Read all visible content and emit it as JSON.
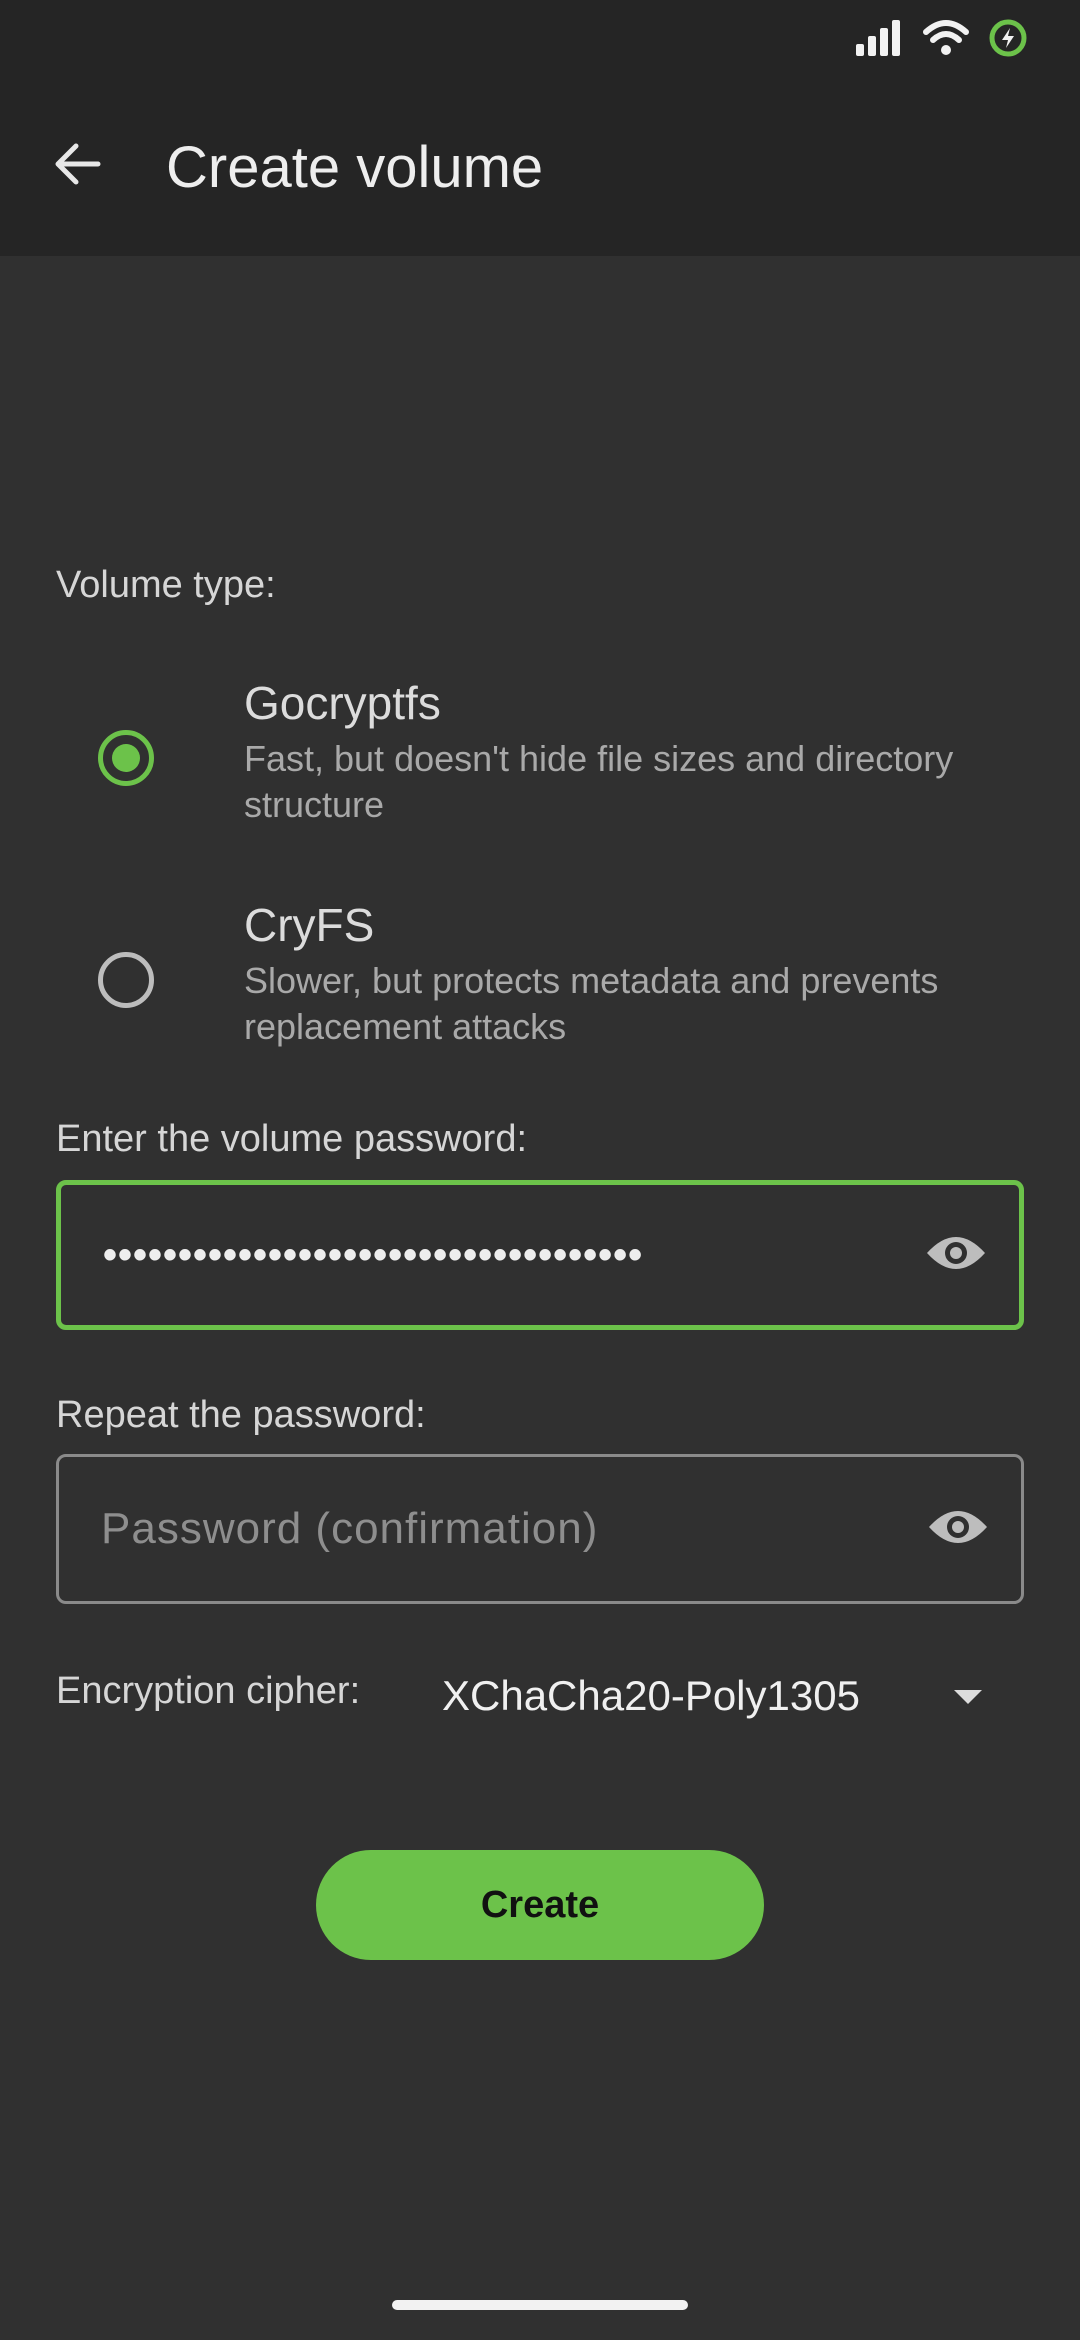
{
  "header": {
    "title": "Create volume",
    "back_icon": "arrow-back-icon"
  },
  "status_bar": {
    "icons": [
      "signal-icon",
      "wifi-icon",
      "battery-charging-icon"
    ]
  },
  "volume_type": {
    "label": "Volume type:",
    "options": [
      {
        "title": "Gocryptfs",
        "description": "Fast, but doesn't hide file sizes and directory structure",
        "selected": true
      },
      {
        "title": "CryFS",
        "description": "Slower, but protects metadata and prevents replacement attacks",
        "selected": false
      }
    ]
  },
  "password": {
    "label": "Enter the volume password:",
    "value": "••••••••••••••••••••••••••••••••••••",
    "toggle_icon": "eye-icon"
  },
  "repeat_password": {
    "label": "Repeat the password:",
    "placeholder": "Password (confirmation)",
    "toggle_icon": "eye-icon"
  },
  "cipher": {
    "label": "Encryption cipher:",
    "selected": "XChaCha20-Poly1305"
  },
  "create_button": {
    "label": "Create"
  },
  "colors": {
    "accent": "#6cc24a",
    "background": "#303030",
    "toolbar": "#252525"
  }
}
